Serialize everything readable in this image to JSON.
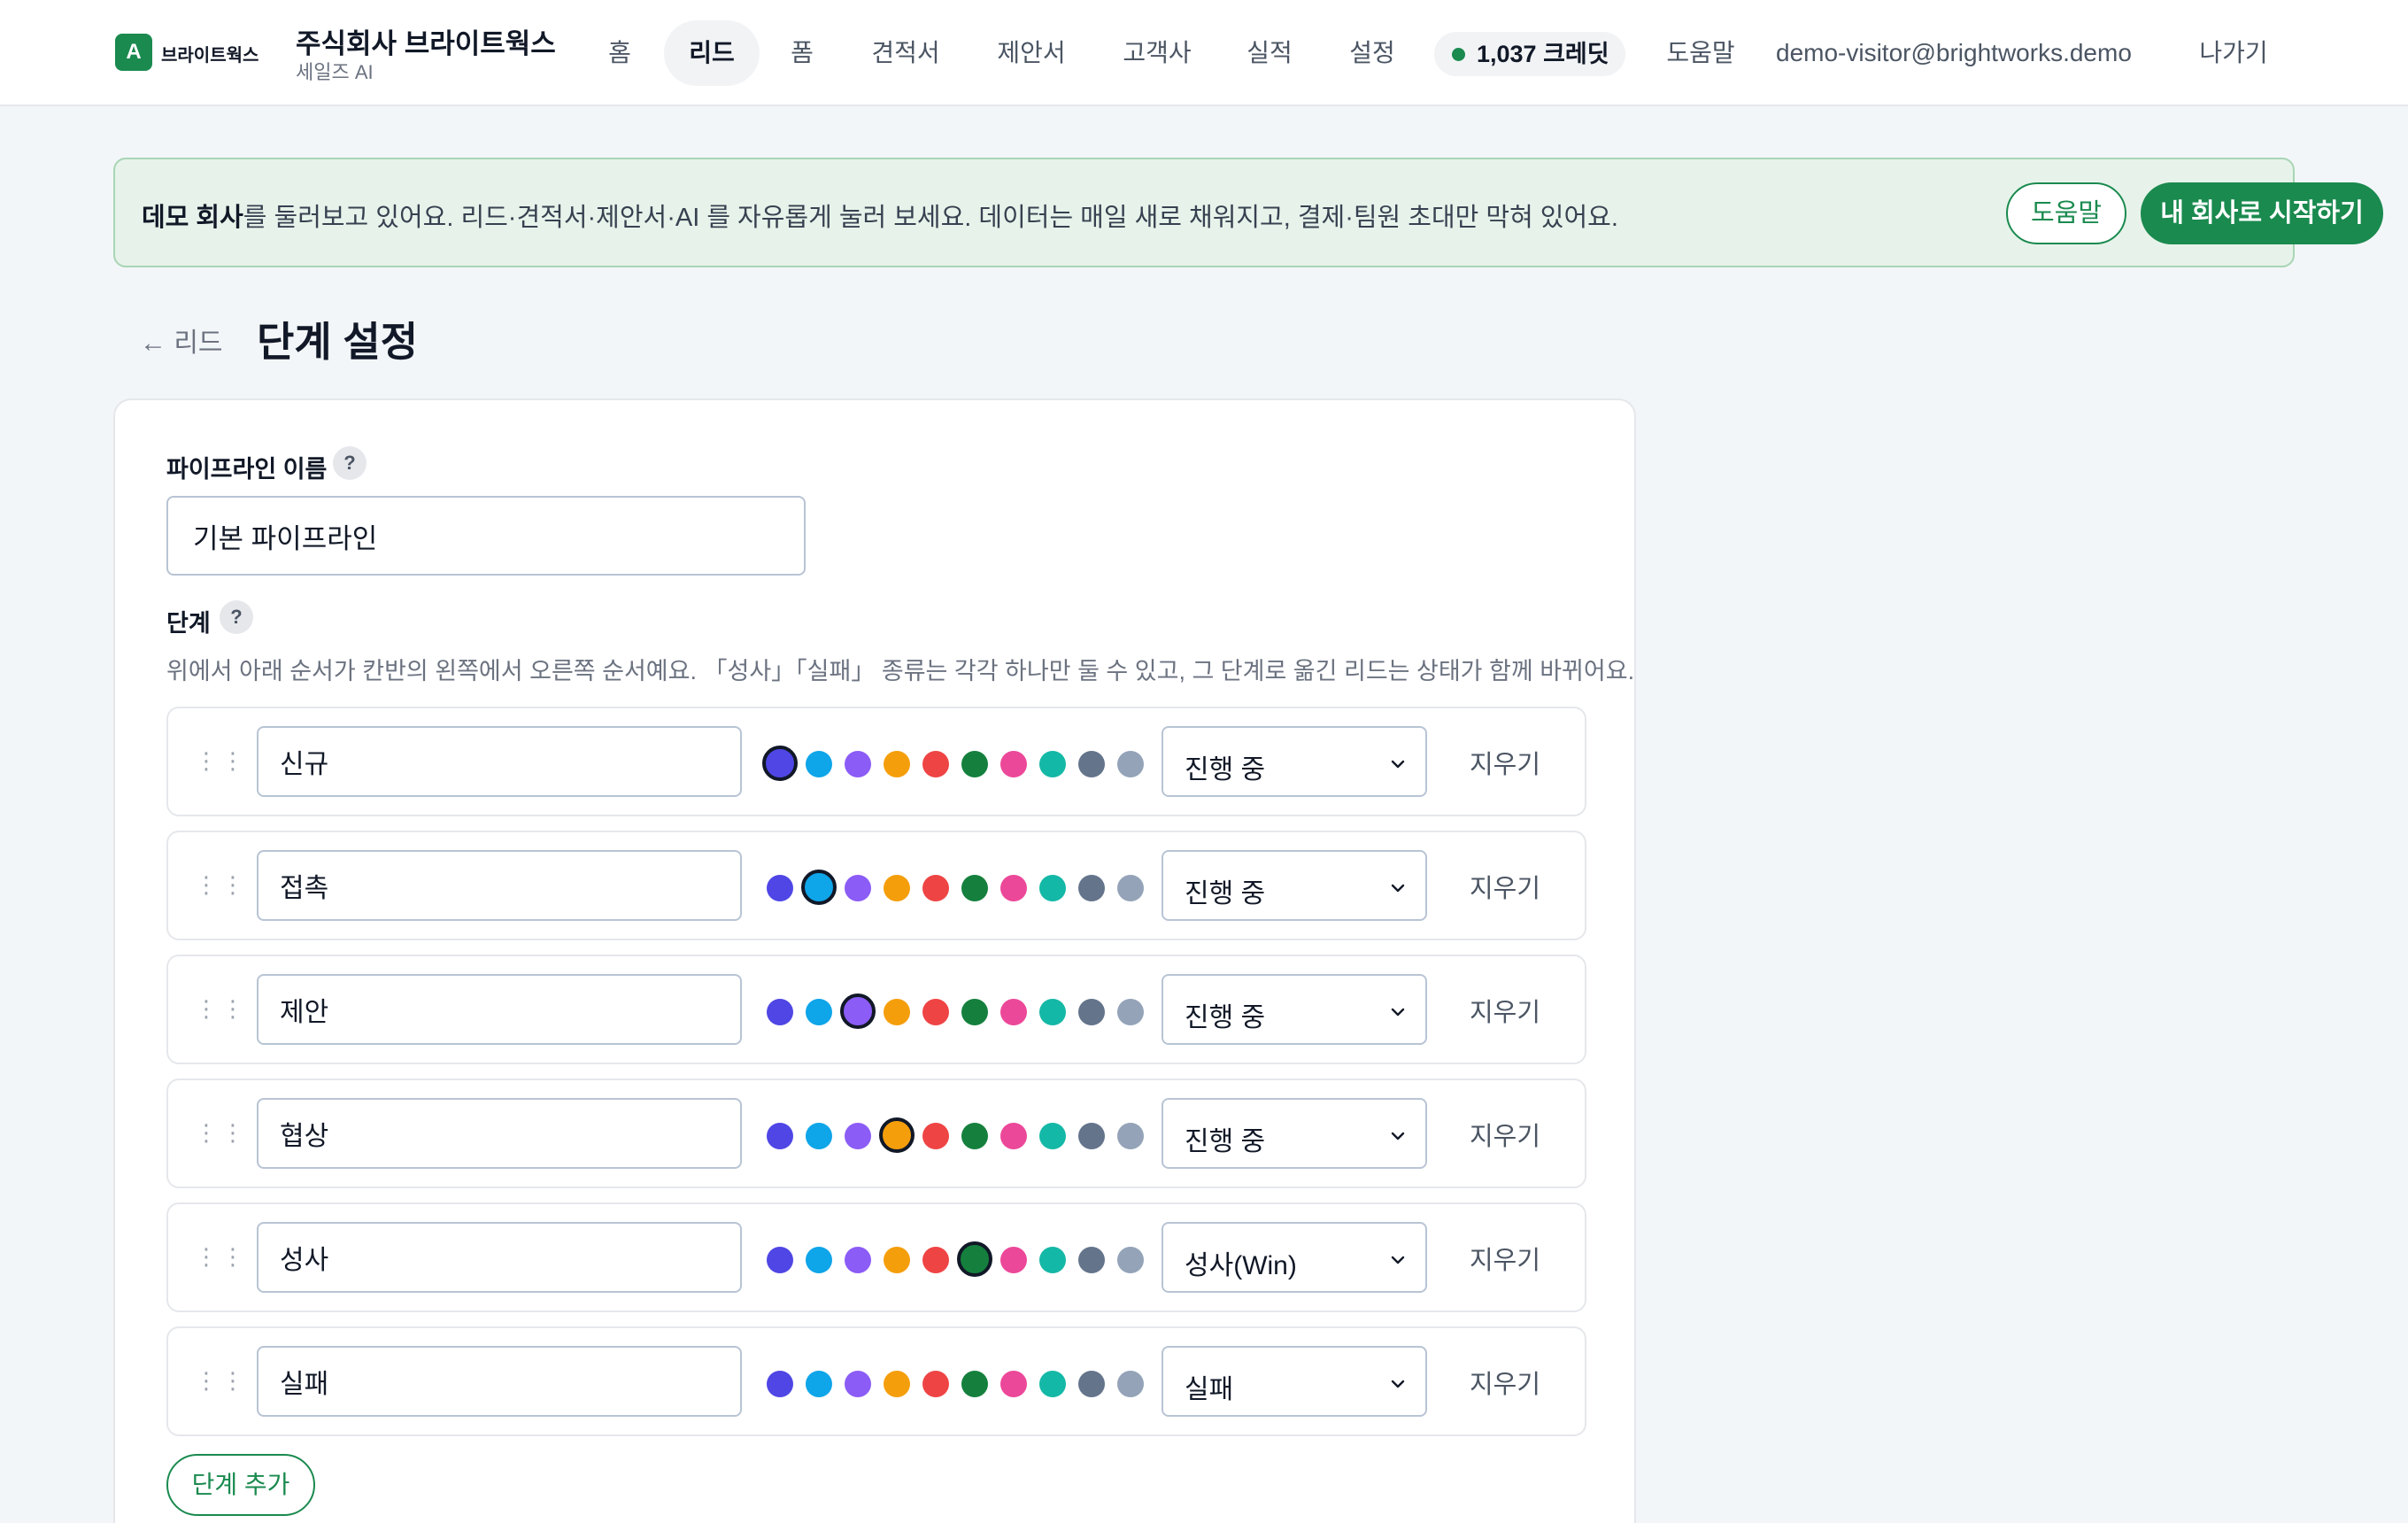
{
  "brand": {
    "logo_glyph": "A",
    "logo_text": "브라이트웍스",
    "company": "주식회사 브라이트웍스",
    "subtitle": "세일즈 AI",
    "accent": "#1a8a4f"
  },
  "nav": {
    "items": [
      {
        "label": "홈",
        "active": false
      },
      {
        "label": "리드",
        "active": true
      },
      {
        "label": "폼",
        "active": false
      },
      {
        "label": "견적서",
        "active": false
      },
      {
        "label": "제안서",
        "active": false
      },
      {
        "label": "고객사",
        "active": false
      },
      {
        "label": "실적",
        "active": false
      },
      {
        "label": "설정",
        "active": false
      }
    ],
    "credits": "1,037 크레딧",
    "help": "도움말",
    "email": "demo-visitor@brightworks.demo",
    "logout": "나가기"
  },
  "banner": {
    "bold": "데모 회사",
    "text": "를 둘러보고 있어요. 리드·견적서·제안서·AI 를 자유롭게 눌러 보세요. 데이터는 매일 새로 채워지고, 결제·팀원 초대만 막혀 있어요.",
    "help_button": "도움말",
    "start_button": "내 회사로 시작하기"
  },
  "header": {
    "back": "← 리드",
    "title": "단계 설정"
  },
  "form": {
    "pipeline_label": "파이프라인 이름",
    "help_glyph": "?",
    "pipeline_value": "기본 파이프라인",
    "stages_label": "단계",
    "stages_desc": "위에서 아래 순서가 칸반의 왼쪽에서 오른쪽 순서예요. 「성사」「실패」 종류는 각각 하나만 둘 수 있고, 그 단계로 옮긴 리드는 상태가 함께 바뀌어요.",
    "delete_label": "지우기",
    "add_stage": "단계 추가",
    "palette": [
      "#4f46e5",
      "#0ea5e9",
      "#8b5cf6",
      "#f59e0b",
      "#ef4444",
      "#15803d",
      "#ec4899",
      "#14b8a6",
      "#64748b",
      "#94a3b8"
    ],
    "stages": [
      {
        "name": "신규",
        "type": "진행 중",
        "selected_color": 0
      },
      {
        "name": "접촉",
        "type": "진행 중",
        "selected_color": 1
      },
      {
        "name": "제안",
        "type": "진행 중",
        "selected_color": 2
      },
      {
        "name": "협상",
        "type": "진행 중",
        "selected_color": 3
      },
      {
        "name": "성사",
        "type": "성사(Win)",
        "selected_color": 5
      },
      {
        "name": "실패",
        "type": "실패",
        "selected_color": -1
      }
    ]
  }
}
